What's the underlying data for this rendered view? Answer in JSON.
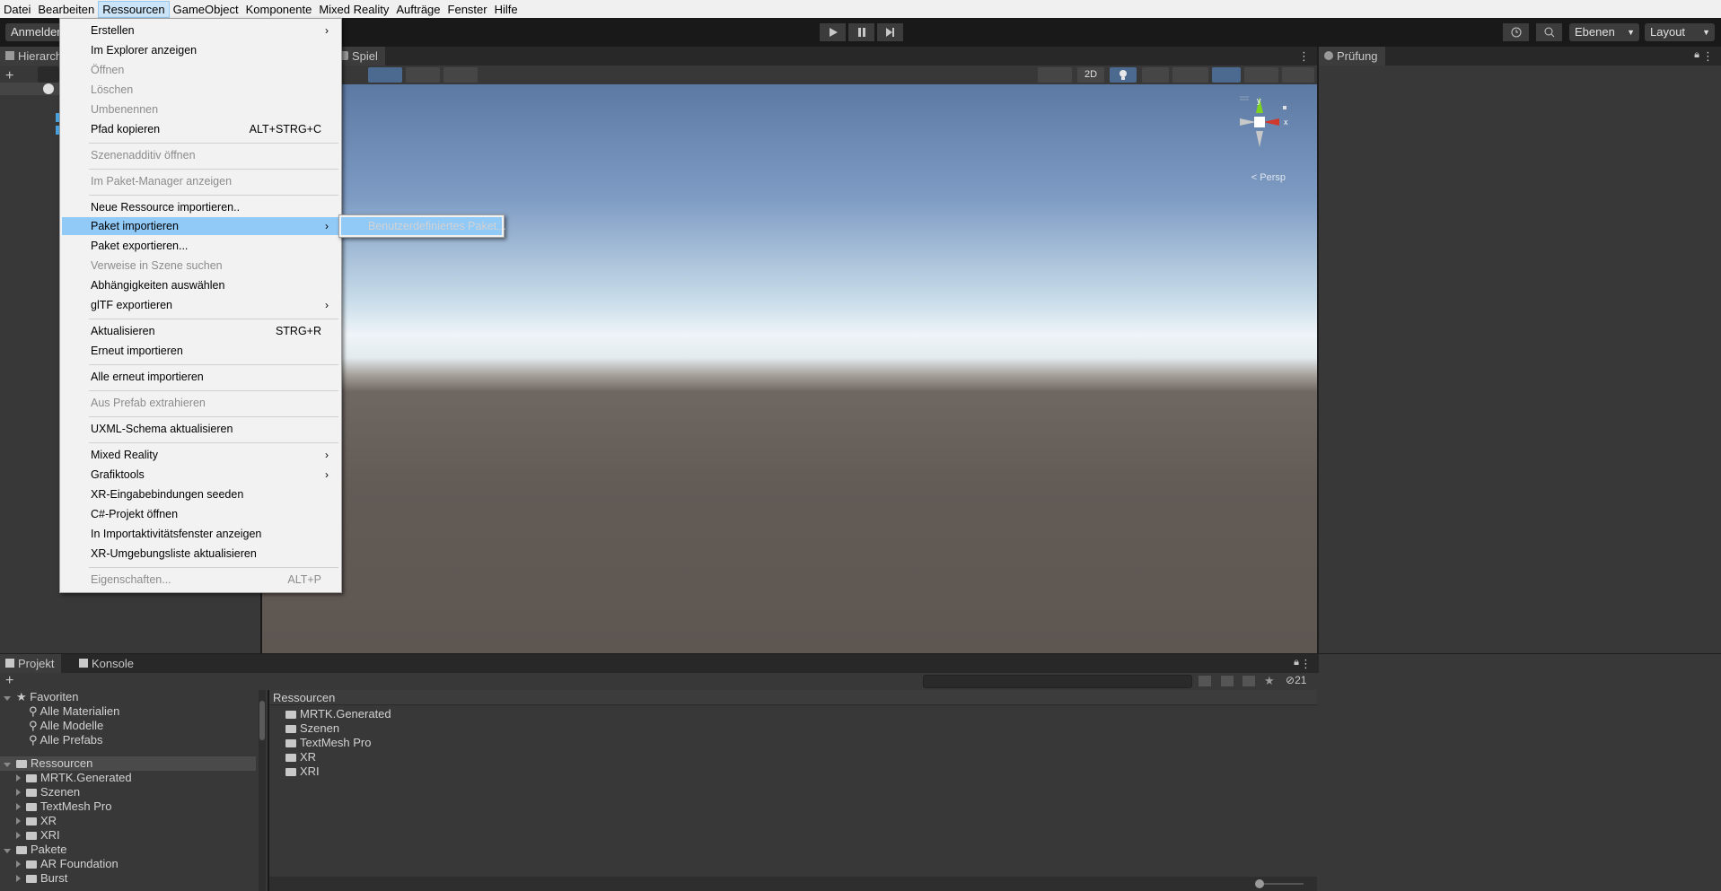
{
  "menubar": {
    "items": [
      "Datei",
      "Bearbeiten",
      "Ressourcen",
      "GameObject",
      "Komponente",
      "Mixed Reality",
      "Aufträge",
      "Fenster",
      "Hilfe"
    ],
    "active_index": 2
  },
  "toolbar": {
    "account_label": "Anmelden",
    "layers_label": "Ebenen",
    "layout_label": "Layout"
  },
  "hierarchy": {
    "tab_label": "Hierarch"
  },
  "scene": {
    "game_tab_label": "Spiel",
    "mode_2d_label": "2D",
    "gizmo_persp_label": "< Persp",
    "gizmo_y": "y",
    "gizmo_x": "x"
  },
  "inspector": {
    "tab_label": "Prüfung"
  },
  "context_menu": {
    "items": [
      {
        "label": "Erstellen",
        "submenu": true
      },
      {
        "label": "Im Explorer anzeigen"
      },
      {
        "label": "Öffnen",
        "disabled": true
      },
      {
        "label": "Löschen",
        "disabled": true
      },
      {
        "label": "Umbenennen",
        "disabled": true
      },
      {
        "label": "Pfad kopieren",
        "shortcut": "ALT+STRG+C"
      },
      {
        "label": "Szenenadditiv öffnen",
        "disabled": true
      },
      {
        "label": "Im Paket-Manager anzeigen",
        "disabled": true
      },
      {
        "label": "Neue Ressource importieren.."
      },
      {
        "label": "Paket importieren",
        "submenu": true,
        "highlighted": true
      },
      {
        "label": "Paket exportieren..."
      },
      {
        "label": "Verweise in Szene suchen",
        "disabled": true
      },
      {
        "label": "Abhängigkeiten auswählen"
      },
      {
        "label": "glTF exportieren",
        "submenu": true
      },
      {
        "label": "Aktualisieren",
        "shortcut": "STRG+R"
      },
      {
        "label": "Erneut importieren"
      },
      {
        "label": "Alle erneut importieren"
      },
      {
        "label": "Aus Prefab extrahieren",
        "disabled": true
      },
      {
        "label": "UXML-Schema aktualisieren"
      },
      {
        "label": "Mixed Reality",
        "submenu": true
      },
      {
        "label": "Grafiktools",
        "submenu": true
      },
      {
        "label": "XR-Eingabebindungen seeden"
      },
      {
        "label": "C#-Projekt öffnen"
      },
      {
        "label": "In Importaktivitätsfenster anzeigen"
      },
      {
        "label": "XR-Umgebungsliste aktualisieren"
      },
      {
        "label": "Eigenschaften...",
        "shortcut": "ALT+P",
        "disabled": true
      }
    ],
    "submenu_item": "Benutzerdefiniertes Paket..."
  },
  "project": {
    "tab_project": "Projekt",
    "tab_console": "Konsole",
    "hidden_count": "21",
    "tree": {
      "favorites_label": "Favoriten",
      "favorites": [
        "Alle Materialien",
        "Alle Modelle",
        "Alle Prefabs"
      ],
      "assets_label": "Ressourcen",
      "assets": [
        "MRTK.Generated",
        "Szenen",
        "TextMesh Pro",
        "XR",
        "XRI"
      ],
      "packages_label": "Pakete",
      "packages": [
        "AR Foundation",
        "Burst"
      ]
    },
    "list_header": "Ressourcen",
    "list": [
      "MRTK.Generated",
      "Szenen",
      "TextMesh Pro",
      "XR",
      "XRI"
    ]
  }
}
